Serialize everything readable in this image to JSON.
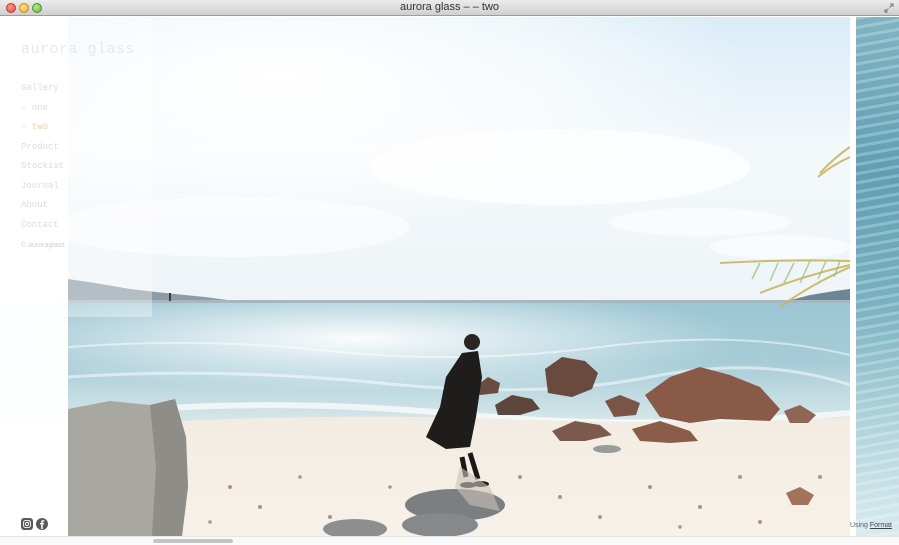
{
  "window": {
    "title": "aurora glass – – two"
  },
  "sidebar": {
    "site_title": "aurora glass",
    "nav": [
      {
        "label": "Gallery",
        "active": false
      },
      {
        "label": "– one",
        "active": false
      },
      {
        "label": "– two",
        "active": true
      },
      {
        "label": "Product",
        "active": false
      },
      {
        "label": "Stockist",
        "active": false
      },
      {
        "label": "Journal",
        "active": false
      },
      {
        "label": "About",
        "active": false
      },
      {
        "label": "Contact",
        "active": false
      }
    ],
    "copyright": "© auroraglass.",
    "social": [
      "instagram-icon",
      "facebook-icon"
    ]
  },
  "footer": {
    "using": "Using",
    "format_link": "Format"
  },
  "colors": {
    "active_nav": "#f7cba2",
    "nav_text": "#dcdcdc"
  }
}
